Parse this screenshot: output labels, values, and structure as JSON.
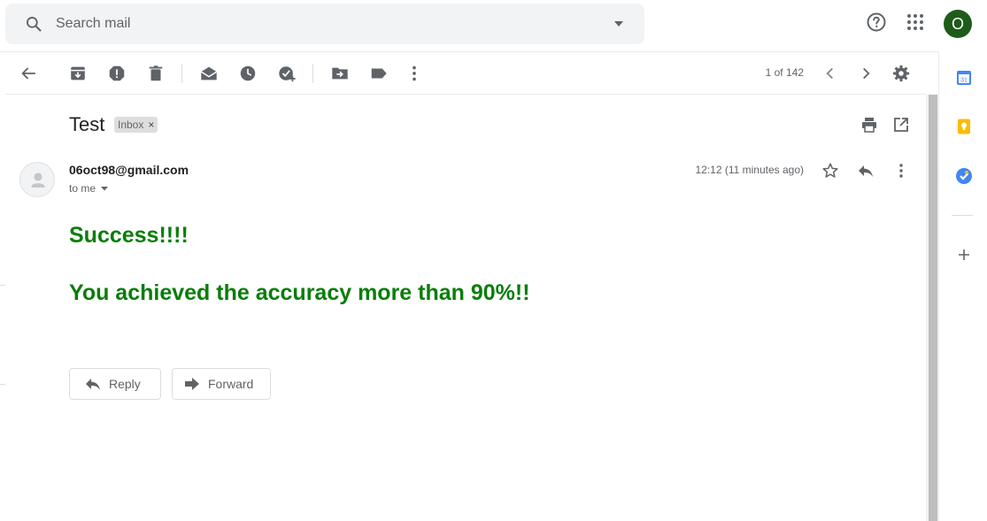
{
  "search": {
    "placeholder": "Search mail"
  },
  "header": {
    "avatar_initial": "O"
  },
  "toolbar": {
    "pager": "1 of 142"
  },
  "message": {
    "subject": "Test",
    "label": "Inbox",
    "label_remove": "×",
    "sender": "06oct98@gmail.com",
    "recipient": "to me",
    "time": "12:12 (11 minutes ago)",
    "body": [
      "Success!!!!",
      "You achieved the accuracy more than 90%!!"
    ],
    "body_color": "#0a7d0a"
  },
  "actions": {
    "reply": "Reply",
    "forward": "Forward"
  },
  "colors": {
    "avatar_bg": "#1e5c1a",
    "search_bg": "#f1f3f4"
  },
  "icons": {
    "header": [
      "help-icon",
      "apps-grid-icon"
    ],
    "toolbar": [
      "back-arrow-icon",
      "archive-icon",
      "report-spam-icon",
      "delete-icon",
      "mark-unread-icon",
      "snooze-icon",
      "add-to-tasks-icon",
      "move-to-icon",
      "labels-icon",
      "more-vert-icon",
      "prev-icon",
      "next-icon",
      "settings-icon"
    ],
    "side": [
      "calendar-icon",
      "keep-icon",
      "tasks-icon",
      "add-addon-icon"
    ]
  }
}
